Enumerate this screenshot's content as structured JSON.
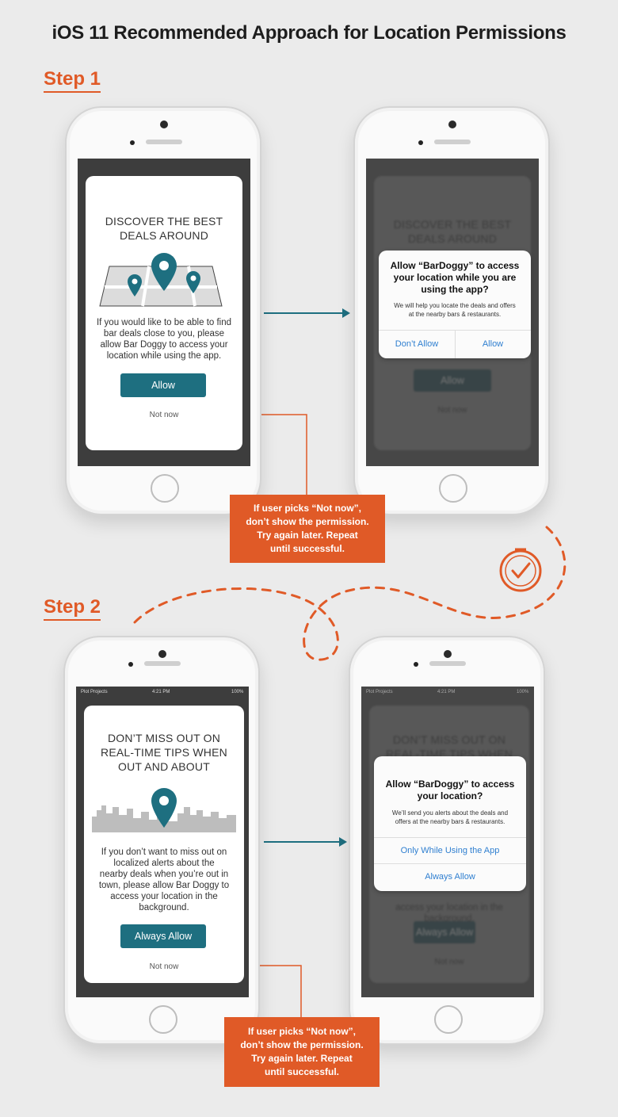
{
  "title": "iOS 11 Recommended Approach for Location Permissions",
  "step1": {
    "label": "Step 1",
    "card": {
      "title_l1": "DISCOVER THE BEST",
      "title_l2": "DEALS AROUND",
      "body_l1": "If you would like to be able to find",
      "body_l2": "bar deals close to you, please",
      "body_l3": "allow Bar Doggy to access your",
      "body_l4": "location while using the app.",
      "button": "Allow",
      "not_now": "Not now"
    },
    "alert": {
      "title_l1": "Allow “BarDoggy” to access",
      "title_l2": "your location while you are",
      "title_l3": "using the app?",
      "msg_l1": "We will help you locate the deals and offers",
      "msg_l2": "at the nearby bars & restaurants.",
      "dont_allow": "Don’t Allow",
      "allow": "Allow"
    },
    "callout": {
      "l1": "If user picks “Not now”,",
      "l2": "don’t show the permission.",
      "l3": "Try again later. Repeat",
      "l4": "until successful."
    }
  },
  "step2": {
    "label": "Step 2",
    "status": {
      "carrier": "Plot Projects",
      "time": "4:21 PM",
      "battery": "100%"
    },
    "card": {
      "title_l1": "DON’T MISS OUT ON",
      "title_l2": "REAL-TIME TIPS WHEN",
      "title_l3": "OUT AND ABOUT",
      "body_l1": "If you don’t want to miss out on",
      "body_l2": "localized alerts about the",
      "body_l3": "nearby deals when you’re out in",
      "body_l4": "town, please allow Bar Doggy to",
      "body_l5": "access your location in the",
      "body_l6": "background.",
      "button": "Always Allow",
      "not_now": "Not now"
    },
    "alert": {
      "title_l1": "Allow “BarDoggy” to access",
      "title_l2": "your location?",
      "msg_l1": "We’ll send you alerts about the deals and",
      "msg_l2": "offers at the nearby bars & restaurants.",
      "option1": "Only While Using the App",
      "option2": "Always Allow"
    },
    "callout": {
      "l1": "If user picks “Not now”,",
      "l2": "don’t show the permission.",
      "l3": "Try again later. Repeat",
      "l4": "until successful."
    }
  },
  "colors": {
    "accent": "#e05a27",
    "teal": "#1e6f80",
    "ios_blue": "#2f7fd0"
  },
  "icons": [
    "map-pin-icon",
    "skyline-icon",
    "clock-icon",
    "arrow-right-icon"
  ]
}
